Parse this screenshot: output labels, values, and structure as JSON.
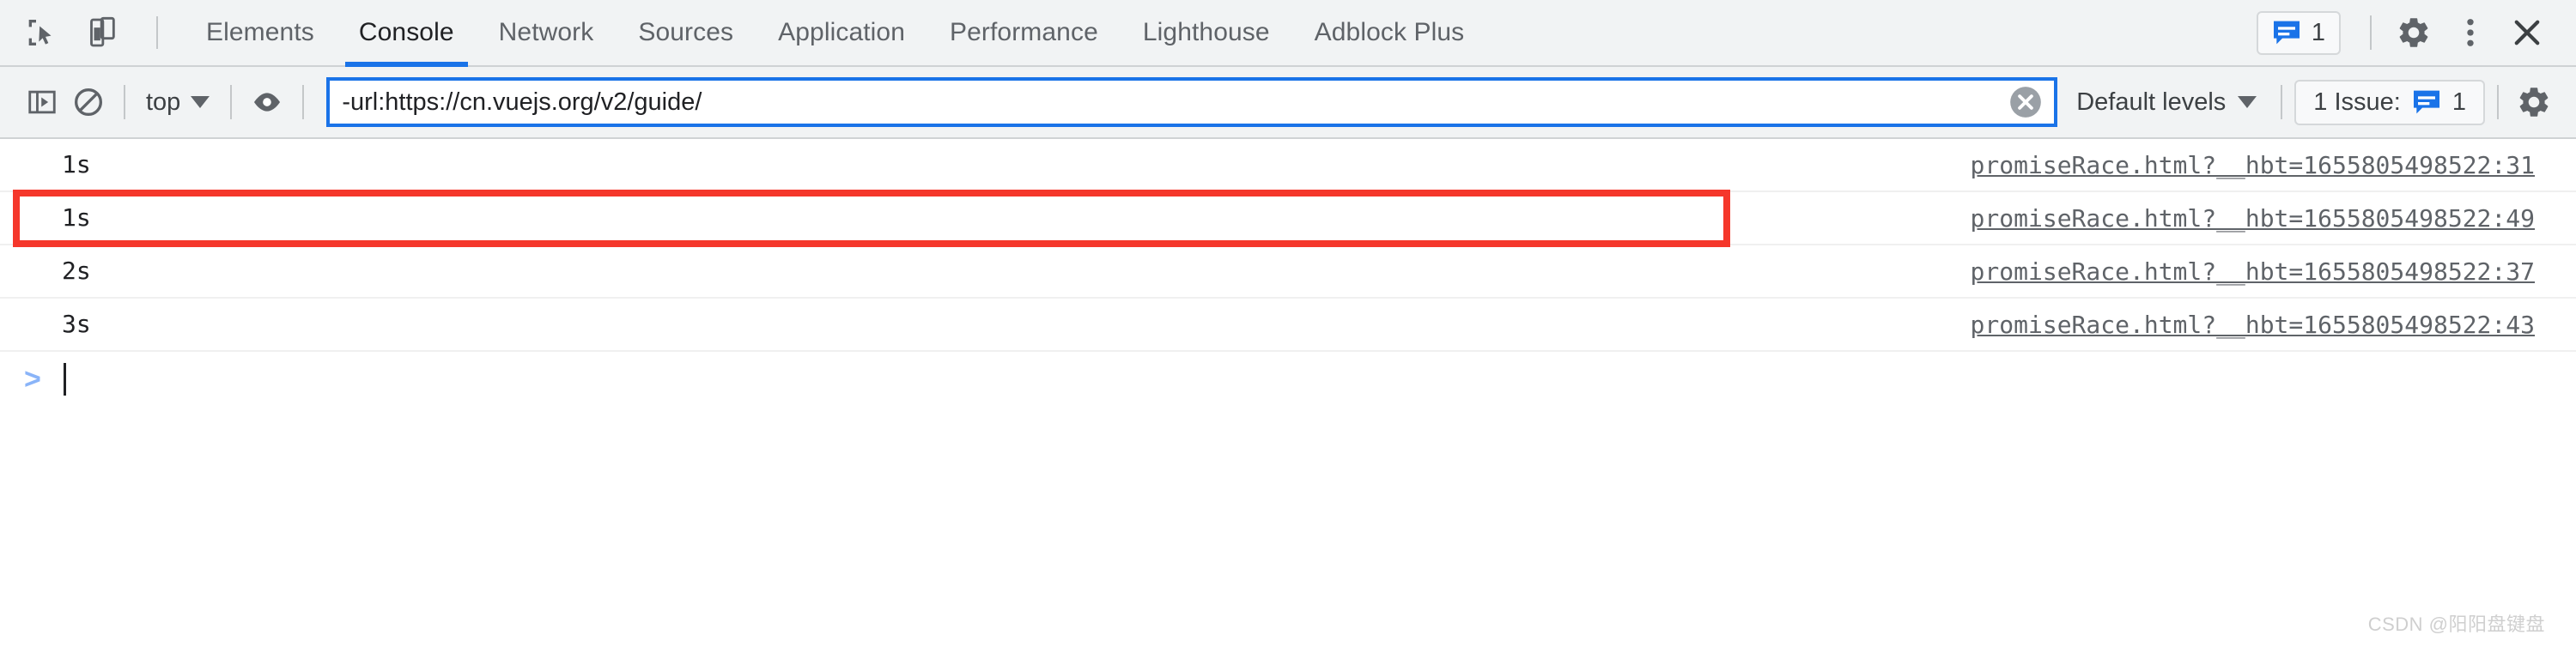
{
  "tabbar": {
    "left_icons": [
      {
        "name": "inspect-element-icon",
        "label": "Inspect element"
      },
      {
        "name": "device-toolbar-icon",
        "label": "Toggle device toolbar"
      }
    ],
    "tabs": [
      {
        "label": "Elements",
        "active": false
      },
      {
        "label": "Console",
        "active": true
      },
      {
        "label": "Network",
        "active": false
      },
      {
        "label": "Sources",
        "active": false
      },
      {
        "label": "Application",
        "active": false
      },
      {
        "label": "Performance",
        "active": false
      },
      {
        "label": "Lighthouse",
        "active": false
      },
      {
        "label": "Adblock Plus",
        "active": false
      }
    ],
    "issues_badge": {
      "icon": "message-icon",
      "count": "1"
    },
    "right_icons": [
      {
        "name": "gear-icon",
        "label": "Settings"
      },
      {
        "name": "kebab-menu-icon",
        "label": "Customize and control DevTools"
      },
      {
        "name": "close-icon",
        "label": "Close DevTools"
      }
    ],
    "active_tab_underline_color": "#1a73e8"
  },
  "toolbar": {
    "sidebar_toggle_icon": "console-sidebar-icon",
    "clear_console_icon": "clear-console-icon",
    "context_selector": {
      "value": "top",
      "caret": "chevron-down-icon"
    },
    "live_expression_icon": "eye-icon",
    "filter": {
      "value": "-url:https://cn.vuejs.org/v2/guide/",
      "placeholder": "Filter",
      "clear_icon": "clear-input-icon",
      "focus_border_color": "#1a73e8"
    },
    "levels_selector": {
      "value": "Default levels",
      "caret": "chevron-down-icon"
    },
    "issues_button": {
      "label": "1 Issue:",
      "icon": "message-icon",
      "count": "1"
    },
    "settings_icon": "gear-icon"
  },
  "console": {
    "rows": [
      {
        "message": "1s",
        "source": "promiseRace.html?__hbt=1655805498522:31",
        "highlighted": false
      },
      {
        "message": "1s",
        "source": "promiseRace.html?__hbt=1655805498522:49",
        "highlighted": true
      },
      {
        "message": "2s",
        "source": "promiseRace.html?__hbt=1655805498522:37",
        "highlighted": false
      },
      {
        "message": "3s",
        "source": "promiseRace.html?__hbt=1655805498522:43",
        "highlighted": false
      }
    ],
    "prompt": {
      "chevron": ">",
      "value": ""
    }
  },
  "annotation": {
    "highlight_color": "#f5372b"
  },
  "watermark": {
    "text": "CSDN @阳阳盘键盘"
  }
}
